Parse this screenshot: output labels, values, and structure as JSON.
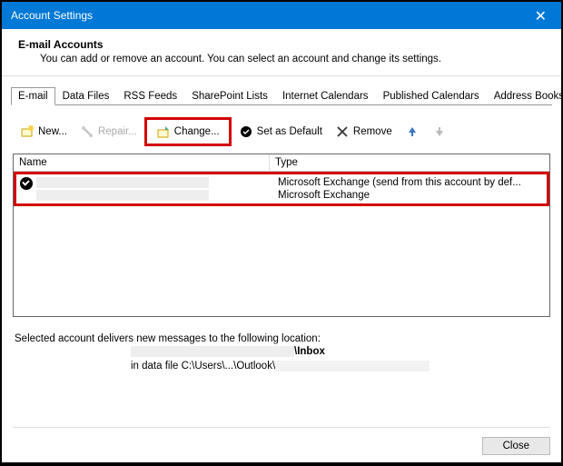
{
  "titlebar": {
    "title": "Account Settings"
  },
  "header": {
    "title": "E-mail Accounts",
    "subtitle": "You can add or remove an account. You can select an account and change its settings."
  },
  "tabs": [
    {
      "label": "E-mail",
      "active": true
    },
    {
      "label": "Data Files"
    },
    {
      "label": "RSS Feeds"
    },
    {
      "label": "SharePoint Lists"
    },
    {
      "label": "Internet Calendars"
    },
    {
      "label": "Published Calendars"
    },
    {
      "label": "Address Books"
    }
  ],
  "toolbar": {
    "new": "New...",
    "repair": "Repair...",
    "change": "Change...",
    "default": "Set as Default",
    "remove": "Remove"
  },
  "table": {
    "col_name": "Name",
    "col_type": "Type",
    "rows": [
      {
        "name": "",
        "type": "Microsoft Exchange (send from this account by def...",
        "default": true
      },
      {
        "name": "",
        "type": "Microsoft Exchange",
        "default": false
      }
    ]
  },
  "footer": {
    "text": "Selected account delivers new messages to the following location:",
    "mailbox_suffix": "\\Inbox",
    "datafile_prefix": "in data file C:\\Users\\...\\Outlook\\"
  },
  "close": {
    "label": "Close"
  }
}
